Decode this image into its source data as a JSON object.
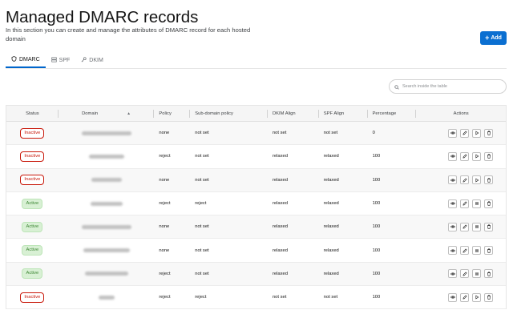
{
  "header": {
    "title": "Managed DMARC records",
    "subtitle": "In this section you can create and manage the attributes of DMARC record for each hosted domain",
    "add_label": "Add"
  },
  "tabs": [
    {
      "label": "DMARC",
      "icon": "shield-icon",
      "active": true
    },
    {
      "label": "SPF",
      "icon": "server-icon",
      "active": false
    },
    {
      "label": "DKIM",
      "icon": "key-icon",
      "active": false
    }
  ],
  "search": {
    "placeholder": "Search inside the table"
  },
  "table": {
    "columns": [
      "Status",
      "Domain",
      "Policy",
      "Sub-domain policy",
      "DKIM Align",
      "SPF Align",
      "Percentage",
      "Actions"
    ],
    "rows": [
      {
        "status": "Inactive",
        "policy": "none",
        "sub": "not set",
        "dkim": "not set",
        "spf": "not set",
        "pct": "0"
      },
      {
        "status": "Inactive",
        "policy": "reject",
        "sub": "not set",
        "dkim": "relaxed",
        "spf": "relaxed",
        "pct": "100"
      },
      {
        "status": "Inactive",
        "policy": "none",
        "sub": "not set",
        "dkim": "relaxed",
        "spf": "relaxed",
        "pct": "100"
      },
      {
        "status": "Active",
        "policy": "reject",
        "sub": "reject",
        "dkim": "relaxed",
        "spf": "relaxed",
        "pct": "100"
      },
      {
        "status": "Active",
        "policy": "none",
        "sub": "not set",
        "dkim": "relaxed",
        "spf": "relaxed",
        "pct": "100"
      },
      {
        "status": "Active",
        "policy": "none",
        "sub": "not set",
        "dkim": "relaxed",
        "spf": "relaxed",
        "pct": "100"
      },
      {
        "status": "Active",
        "policy": "reject",
        "sub": "not set",
        "dkim": "relaxed",
        "spf": "relaxed",
        "pct": "100"
      },
      {
        "status": "Inactive",
        "policy": "reject",
        "sub": "reject",
        "dkim": "not set",
        "spf": "not set",
        "pct": "100"
      }
    ]
  },
  "colors": {
    "accent": "#0b6fd1",
    "inactive": "#c9190b",
    "active_text": "#3e8635",
    "active_bg": "#d8f0d4"
  }
}
